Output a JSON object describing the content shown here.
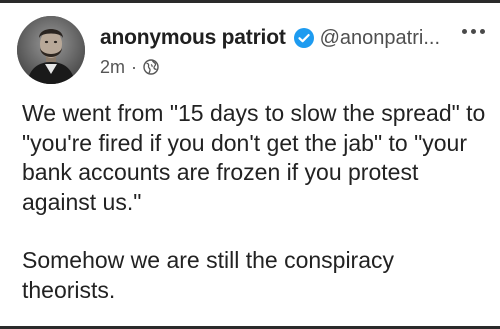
{
  "post": {
    "author": {
      "display_name": "anonymous patriot",
      "handle": "@anonpatri...",
      "verified": true,
      "avatar_icon": "portrait-avatar-icon"
    },
    "timestamp": "2m",
    "separator": "·",
    "audience_icon": "globe-icon",
    "more_icon": "more-options-icon",
    "paragraphs": [
      "We went from \"15 days to slow the spread\" to \"you're fired if you don't get the jab\" to \"your bank accounts are frozen if you protest against us.\"",
      "Somehow we are still the conspiracy theorists."
    ]
  },
  "colors": {
    "verified_badge": "#1d9bf0",
    "text": "#222222",
    "frame_border": "#2a2a2a"
  }
}
